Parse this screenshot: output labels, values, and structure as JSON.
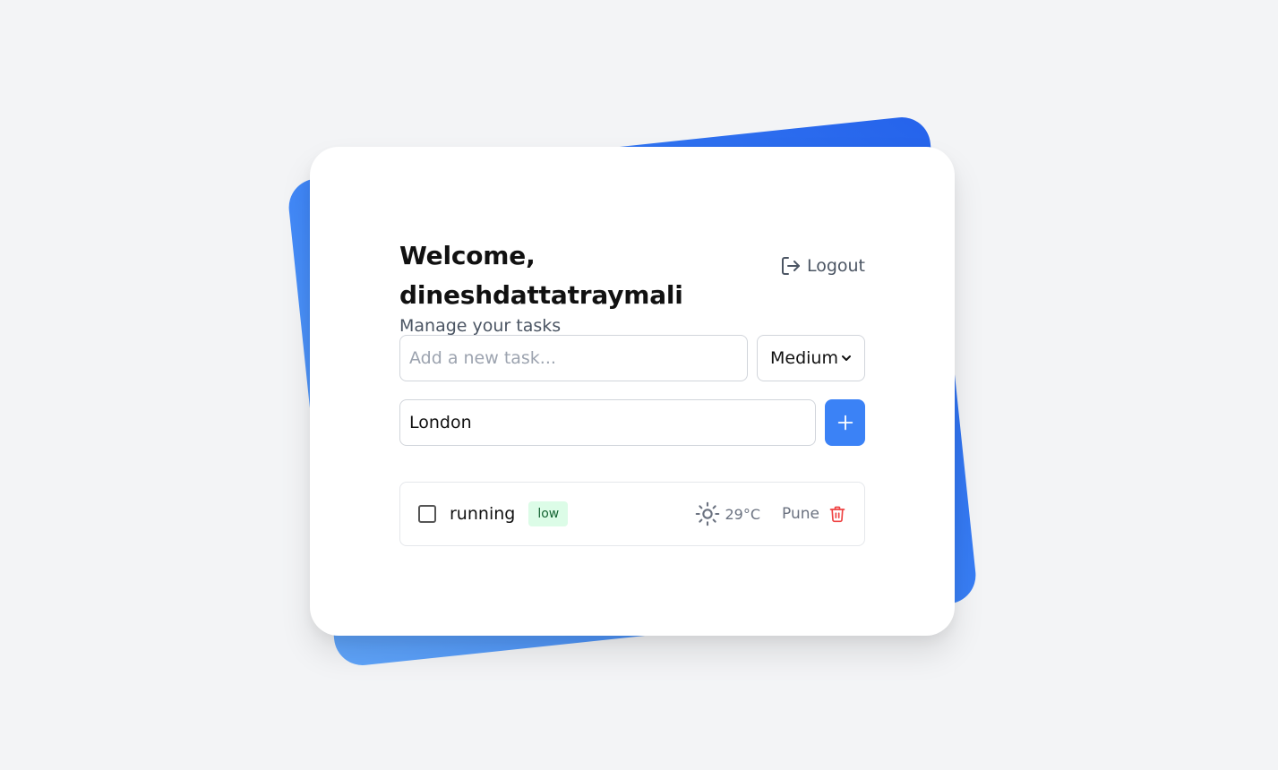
{
  "header": {
    "title": "Welcome, dineshdattatraymali",
    "subtitle": "Manage your tasks",
    "logout_label": "Logout",
    "logout_icon": "logout-icon"
  },
  "form": {
    "task_placeholder": "Add a new task...",
    "task_value": "",
    "priority_selected": "Medium",
    "location_value": "London",
    "add_icon": "plus-icon"
  },
  "tasks": [
    {
      "text": "running",
      "checked": false,
      "priority": "low",
      "weather_icon": "sun-icon",
      "temperature": "29°C",
      "location": "Pune",
      "delete_icon": "trash-icon"
    }
  ],
  "colors": {
    "accent": "#3b82f6",
    "badge_low_bg": "#dcfce7",
    "badge_low_text": "#166534",
    "delete": "#ef4444",
    "background": "#f3f4f6"
  }
}
